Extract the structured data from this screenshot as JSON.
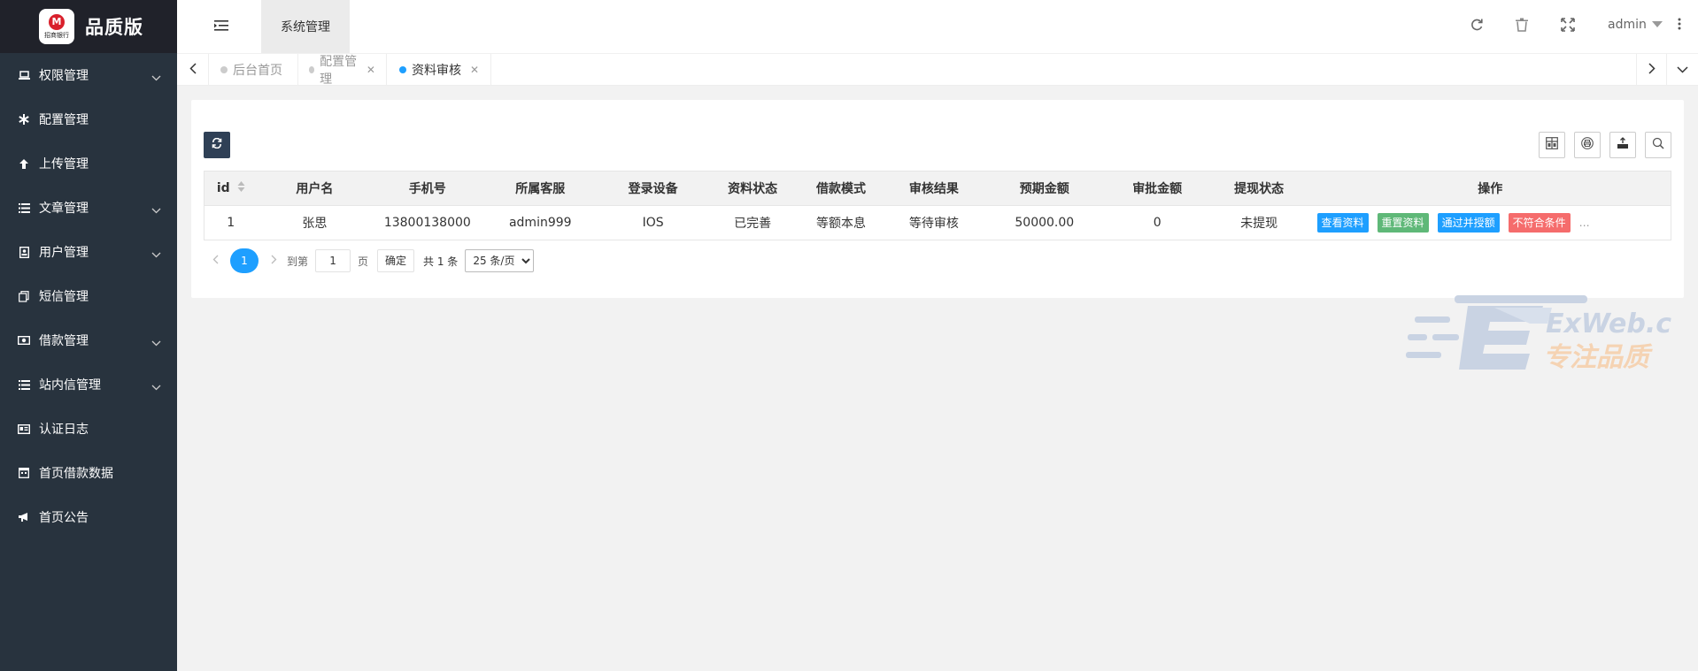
{
  "brand": {
    "title": "品质版",
    "logo_mark": "M",
    "logo_sub": "招商银行",
    "logo_tag": ""
  },
  "sidebar": {
    "items": [
      {
        "label": "权限管理",
        "icon": "laptop-icon",
        "has_children": true
      },
      {
        "label": "配置管理",
        "icon": "asterisk-icon",
        "has_children": false
      },
      {
        "label": "上传管理",
        "icon": "arrow-up-icon",
        "has_children": false
      },
      {
        "label": "文章管理",
        "icon": "list-icon",
        "has_children": true
      },
      {
        "label": "用户管理",
        "icon": "user-card-icon",
        "has_children": true
      },
      {
        "label": "短信管理",
        "icon": "copy-icon",
        "has_children": false
      },
      {
        "label": "借款管理",
        "icon": "money-icon",
        "has_children": true
      },
      {
        "label": "站内信管理",
        "icon": "list-icon",
        "has_children": true
      },
      {
        "label": "认证日志",
        "icon": "id-card-icon",
        "has_children": false
      },
      {
        "label": "首页借款数据",
        "icon": "calendar-icon",
        "has_children": false
      },
      {
        "label": "首页公告",
        "icon": "bullhorn-icon",
        "has_children": false
      }
    ]
  },
  "header": {
    "system_tab": "系统管理",
    "user": "admin",
    "icons": [
      "refresh-icon",
      "trash-icon",
      "fullscreen-icon",
      "more-vertical-icon"
    ]
  },
  "tabs": [
    {
      "label": "后台首页",
      "active": false,
      "closable": false
    },
    {
      "label": "配置管理",
      "active": false,
      "closable": true
    },
    {
      "label": "资料审核",
      "active": true,
      "closable": true
    }
  ],
  "table": {
    "columns": [
      "id",
      "用户名",
      "手机号",
      "所属客服",
      "登录设备",
      "资料状态",
      "借款模式",
      "审核结果",
      "预期金额",
      "审批金额",
      "提现状态",
      "操作"
    ],
    "rows": [
      {
        "id": "1",
        "username": "张思",
        "phone": "13800138000",
        "agent": "admin999",
        "device": "IOS",
        "data_status": "已完善",
        "loan_mode": "等额本息",
        "review_result": "等待审核",
        "expected_amount": "50000.00",
        "approved_amount": "0",
        "withdraw_status": "未提现",
        "actions": [
          "查看资料",
          "重置资料",
          "通过并授额",
          "不符合条件"
        ],
        "more": "…"
      }
    ]
  },
  "pagination": {
    "current_page": "1",
    "goto_label": "到第",
    "goto_value": "1",
    "page_label": "页",
    "confirm_label": "确定",
    "total_label": "共 1 条",
    "page_size": "25 条/页"
  },
  "watermark": {
    "line1": "ExWeb.cc",
    "line2": "专注品质"
  },
  "colors": {
    "sidebar": "#28333e",
    "logo_bar": "#20222a",
    "accent": "#1e9fff",
    "green": "#5fb878",
    "red": "#f56c6c",
    "dark_btn": "#2f4056"
  }
}
